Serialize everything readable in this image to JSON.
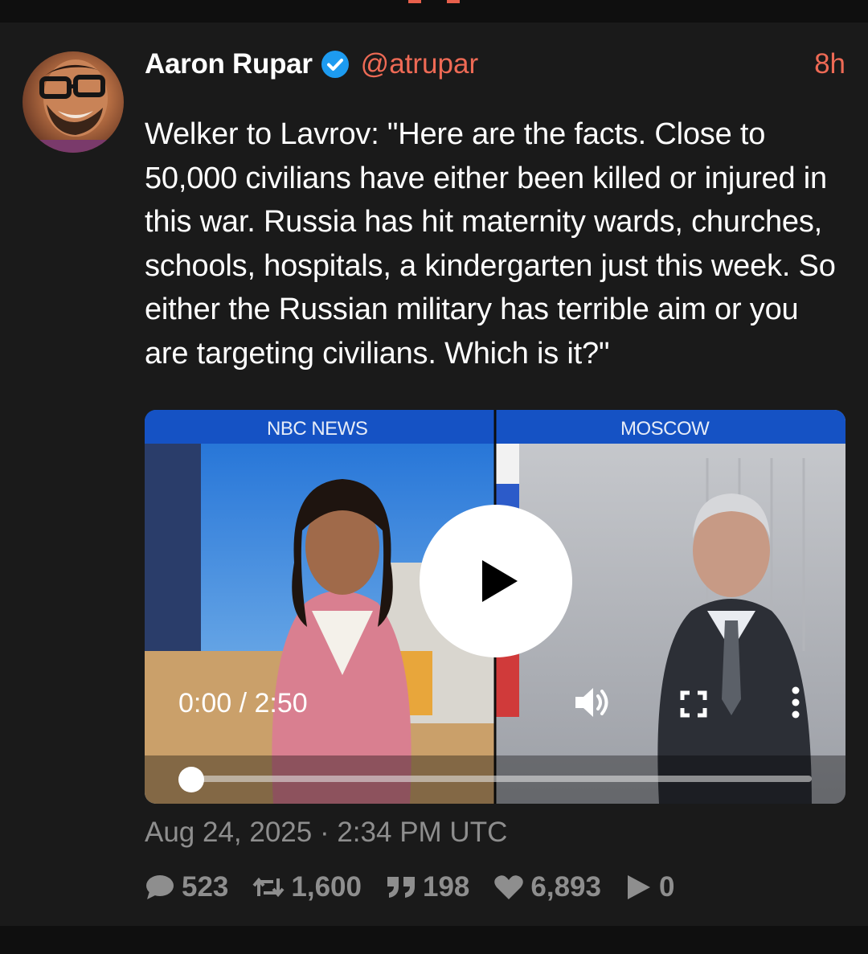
{
  "post": {
    "author": {
      "name": "Aaron Rupar",
      "handle": "@atrupar",
      "verified": true,
      "avatar_icon": "avatar"
    },
    "time_ago": "8h",
    "text": "Welker to Lavrov: \"Here are the facts. Close to 50,000 civilians have either been killed or injured in this war. Russia has hit maternity wards, churches, schools, hospitals, a kindergarten just this week. So either the Russian military has terrible aim or you are targeting civilians. Which is it?\"",
    "video": {
      "left_label": "NBC NEWS",
      "right_label": "MOSCOW",
      "time_display": "0:00 / 2:50",
      "progress": 0,
      "controls": [
        "play-icon",
        "volume-icon",
        "fullscreen-icon",
        "more-icon"
      ]
    },
    "timestamp": "Aug 24, 2025 · 2:34 PM UTC",
    "stats": {
      "replies": "523",
      "reposts": "1,600",
      "quotes": "198",
      "likes": "6,893",
      "views": "0"
    }
  },
  "colors": {
    "background": "#1a1a1a",
    "accent": "#ee6a55",
    "muted": "#8e8e8e",
    "verified": "#1d9bf0"
  }
}
